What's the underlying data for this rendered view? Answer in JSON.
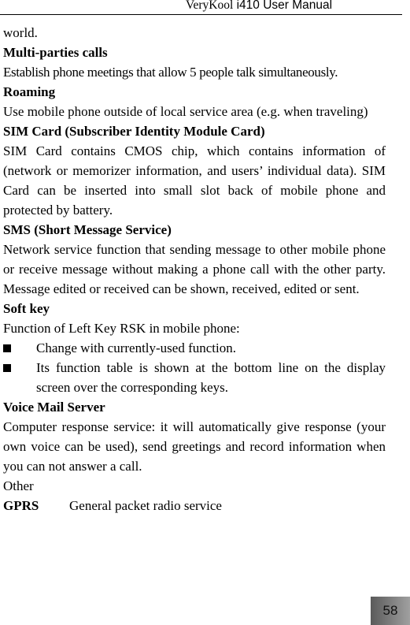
{
  "header": {
    "brand": "VeryKool",
    "title": " i410 User Manual"
  },
  "content": {
    "intro": "world.",
    "multi_parties": {
      "heading": "Multi-parties calls",
      "text": "Establish phone meetings that allow 5 people talk simultaneously."
    },
    "roaming": {
      "heading": "Roaming",
      "text": "Use mobile phone outside of local service area (e.g. when traveling)"
    },
    "sim": {
      "heading": "SIM Card (Subscriber Identity Module Card)",
      "text": "SIM Card contains CMOS chip, which contains information of (network or memorizer information, and users’ individual data). SIM Card can be inserted into small slot back of mobile phone and protected by battery."
    },
    "sms": {
      "heading": "SMS (Short Message Service)",
      "text": "Network service function that sending message to other mobile phone or receive message without making a phone call with the other party. Message edited or received can be shown, received, edited or sent."
    },
    "soft_key": {
      "heading": "Soft key",
      "text": "Function of Left Key RSK in mobile phone:",
      "bullets": [
        "Change with currently-used function.",
        "Its function table is shown at the bottom line on the display screen over the corresponding keys."
      ]
    },
    "voice_mail": {
      "heading": "Voice Mail Server",
      "text": "Computer response service: it will automatically give response (your own voice can be used), send greetings and record information when you can not answer a call."
    },
    "other": {
      "heading": "Other",
      "gprs_term": "GPRS",
      "gprs_def": "General packet radio service"
    }
  },
  "page_number": "58"
}
